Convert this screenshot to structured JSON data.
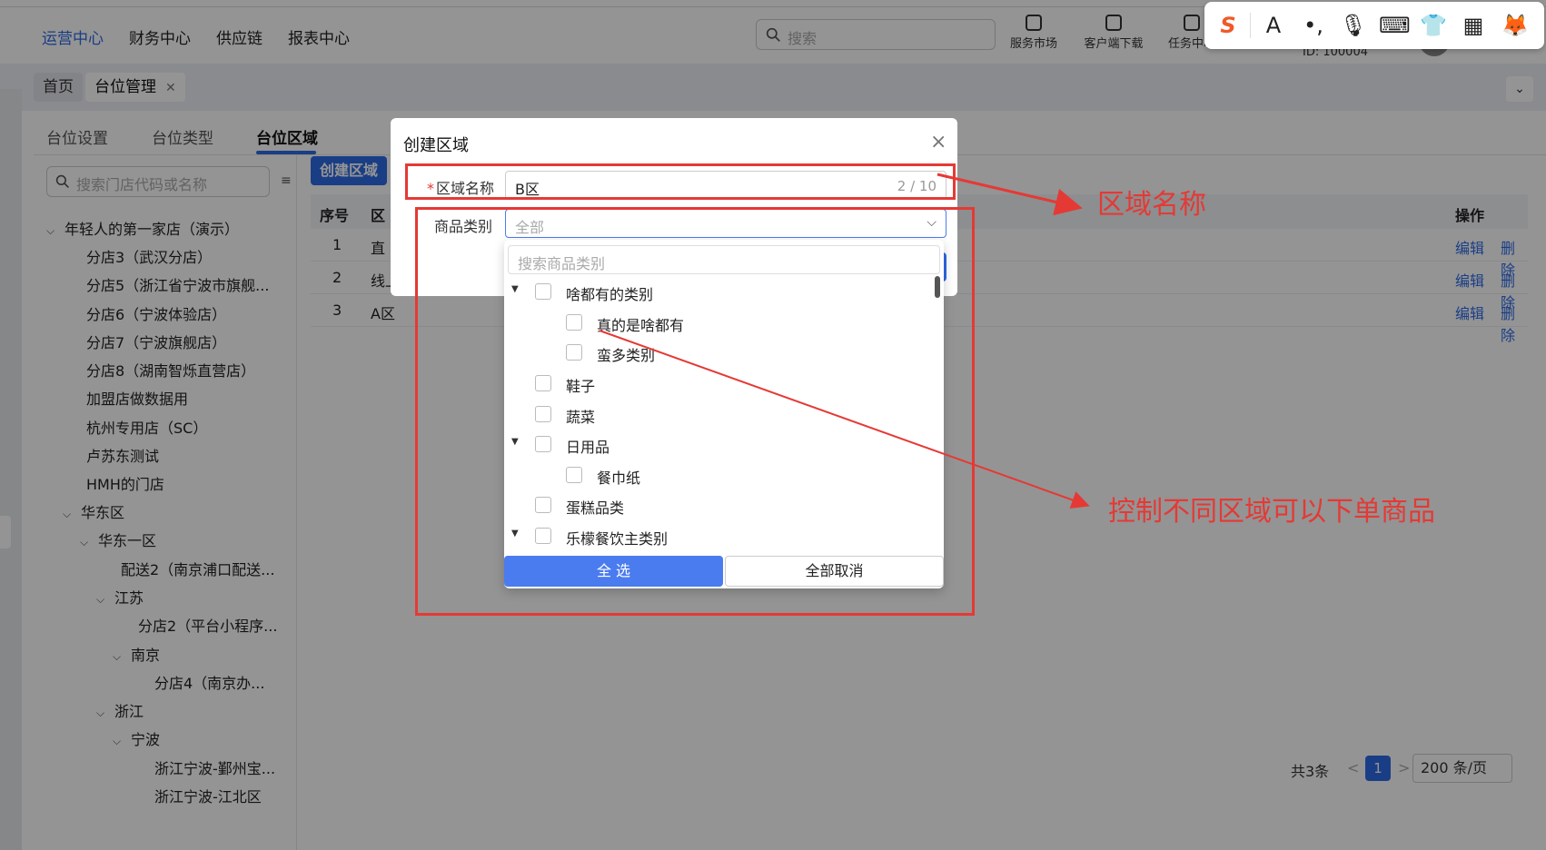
{
  "topnav": {
    "items": [
      "运营中心",
      "财务中心",
      "供应链",
      "报表中心"
    ],
    "search_placeholder": "搜索",
    "tools": [
      "服务市场",
      "客户端下载",
      "任务中心"
    ],
    "user_id": "ID: 100004"
  },
  "ime": {
    "logo": "S",
    "font_icon": "A"
  },
  "crumbs": {
    "home": "首页",
    "current": "台位管理",
    "close": "✕",
    "collapse": "⌄"
  },
  "subtabs": [
    "台位设置",
    "台位类型",
    "台位区域"
  ],
  "tree": {
    "search_placeholder": "搜索门店代码或名称",
    "nodes": [
      "年轻人的第一家店（演示）",
      "分店3（武汉分店）",
      "分店5（浙江省宁波市旗舰...",
      "分店6（宁波体验店）",
      "分店7（宁波旗舰店）",
      "分店8（湖南智烁直营店）",
      "加盟店做数据用",
      "杭州专用店（SC）",
      "卢苏东测试",
      "HMH的门店",
      "华东区",
      "华东一区",
      "配送2（南京浦口配送...",
      "江苏",
      "分店2（平台小程序...",
      "南京",
      "分店4（南京办...",
      "浙江",
      "宁波",
      "浙江宁波-鄞州宝...",
      "浙江宁波-江北区"
    ]
  },
  "main": {
    "create_button": "创建区域",
    "columns": {
      "index": "序号",
      "name": "区",
      "ops": "操作"
    },
    "rows": [
      {
        "index": "1",
        "name": "直"
      },
      {
        "index": "2",
        "name": "线上点单"
      },
      {
        "index": "3",
        "name": "A区"
      }
    ],
    "edit": "编辑",
    "delete": "删除",
    "pager": {
      "total": "共3条",
      "prev": "<",
      "next": ">",
      "page": "1",
      "size": "200 条/页"
    }
  },
  "modal": {
    "title": "创建区域",
    "close": "×",
    "name_label": "区域名称",
    "name_required": "*",
    "name_value": "B区",
    "name_count": "2 / 10",
    "category_label": "商品类别",
    "category_placeholder": "全部"
  },
  "dropdown": {
    "search_placeholder": "搜索商品类别",
    "items": [
      "啥都有的类别",
      "真的是啥都有",
      "蛮多类别",
      "鞋子",
      "蔬菜",
      "日用品",
      "餐巾纸",
      "蛋糕品类",
      "乐檬餐饮主类别"
    ],
    "select_all": "全 选",
    "deselect_all": "全部取消"
  },
  "annotations": {
    "name_note": "区域名称",
    "category_note": "控制不同区域可以下单商品",
    "color": "#e53935"
  },
  "colors": {
    "accent": "#2e6be6",
    "annotation": "#e53935"
  }
}
